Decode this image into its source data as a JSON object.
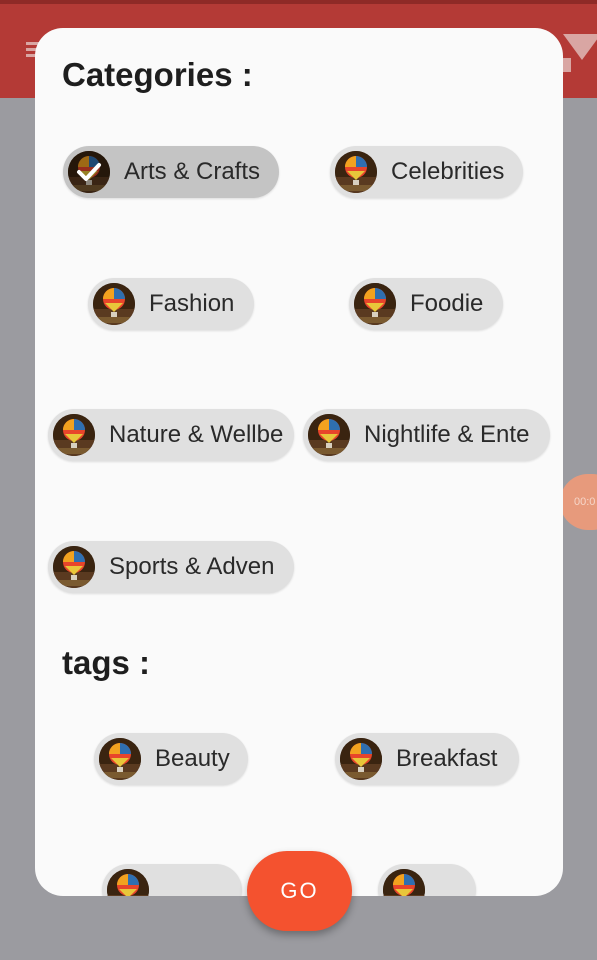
{
  "categories_title": "Categories :",
  "tags_title": "tags :",
  "categories": [
    {
      "label": "Arts & Crafts",
      "selected": true
    },
    {
      "label": "Celebrities",
      "selected": false
    },
    {
      "label": "Fashion",
      "selected": false
    },
    {
      "label": "Foodie",
      "selected": false
    },
    {
      "label": "Nature & Wellbe",
      "selected": false
    },
    {
      "label": "Nightlife & Ente",
      "selected": false
    },
    {
      "label": "Sports & Adven",
      "selected": false
    }
  ],
  "tags": [
    {
      "label": "Beauty",
      "selected": false
    },
    {
      "label": "Breakfast",
      "selected": false
    },
    {
      "label": "",
      "selected": false
    },
    {
      "label": "",
      "selected": false
    }
  ],
  "go_label": "GO",
  "overlay_bubble_text": "00:0",
  "icons": {
    "menu": "menu-icon",
    "filter": "filter-icon",
    "chip_avatar": "hot-air-balloon-image",
    "check": "check-icon"
  },
  "colors": {
    "appbar": "#b43a36",
    "go_button": "#f4522f",
    "chip": "#e0e0e0",
    "chip_selected": "#c4c4c4"
  }
}
